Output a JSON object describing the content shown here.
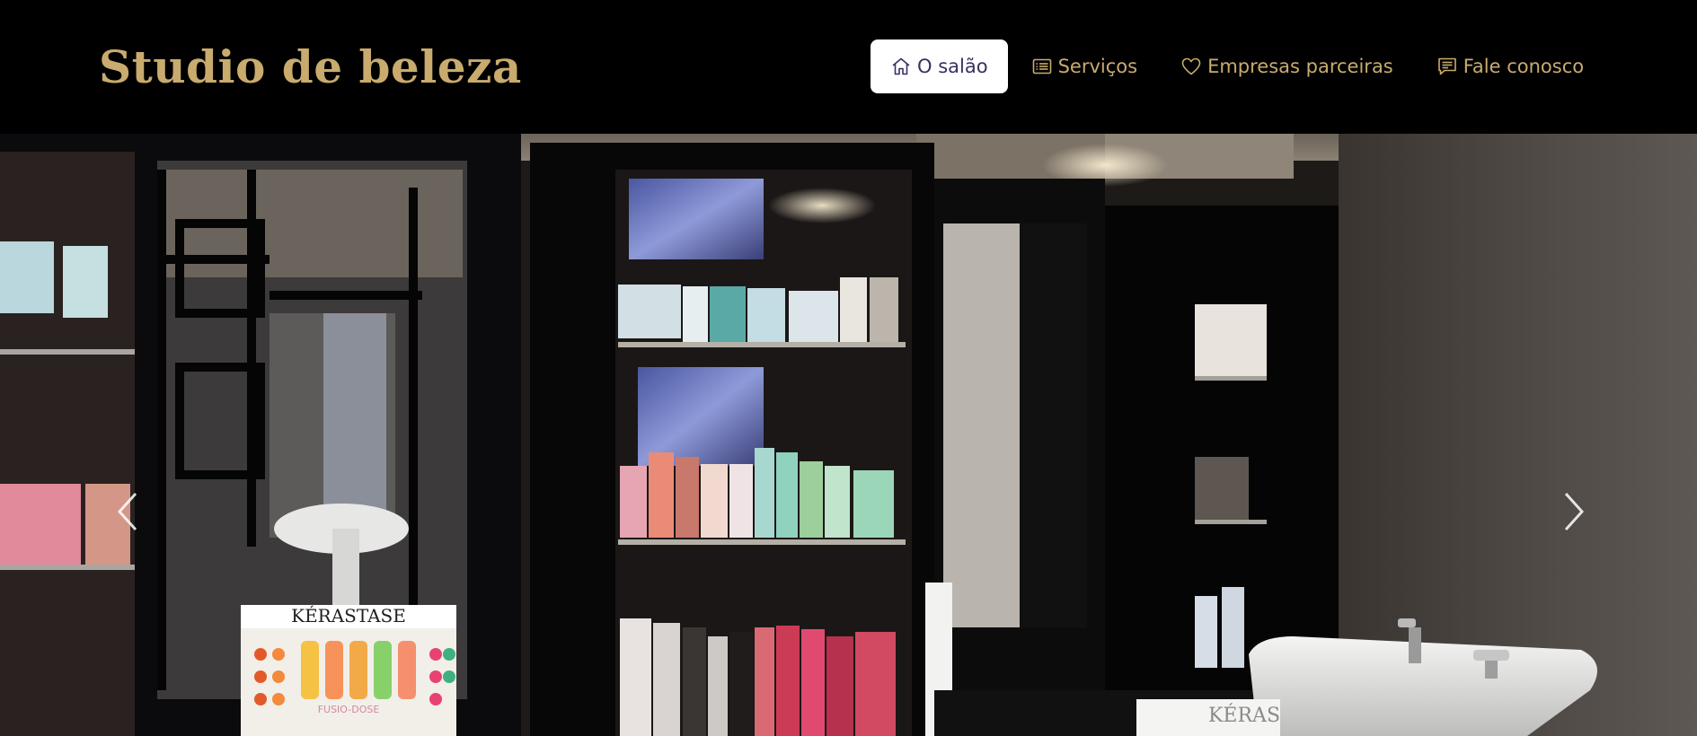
{
  "header": {
    "brand": "Studio de beleza",
    "nav": [
      {
        "label": "O salão",
        "icon": "home-icon",
        "active": true
      },
      {
        "label": "Serviços",
        "icon": "list-icon",
        "active": false
      },
      {
        "label": "Empresas parceiras",
        "icon": "heart-icon",
        "active": false
      },
      {
        "label": "Fale conosco",
        "icon": "message-icon",
        "active": false
      }
    ]
  },
  "hero": {
    "image": "salon-interior-photo",
    "display_brand": "KÉRASTASE",
    "display_sub": "FUSIO-DOSE",
    "sink_brand": "KÉRAS",
    "prev_icon": "chevron-left-icon",
    "next_icon": "chevron-right-icon"
  },
  "colors": {
    "header_bg": "#000000",
    "brand_gold": "#c9ab6e",
    "active_bg": "#ffffff",
    "active_text": "#3b2f63"
  }
}
